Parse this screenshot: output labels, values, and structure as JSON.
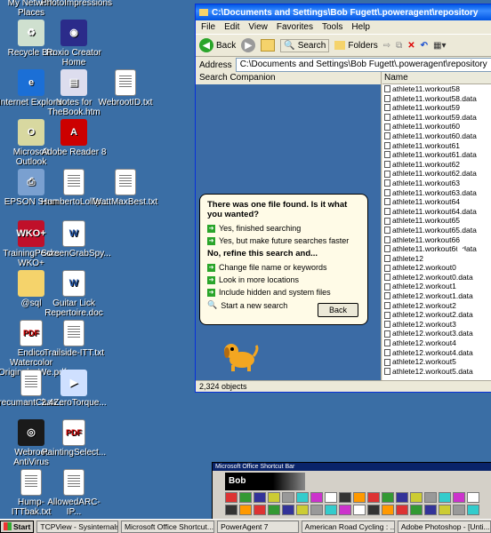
{
  "desktop": {
    "icons": [
      {
        "label": "My Network Places",
        "kind": "network-places"
      },
      {
        "label": "PhotoImpressions",
        "kind": "photoimpression"
      },
      {
        "label": "Recycle Bin",
        "kind": "recycle-bin"
      },
      {
        "label": "Roxio Creator Home",
        "kind": "roxio"
      },
      {
        "label": "Internet Explorer",
        "kind": "ie"
      },
      {
        "label": "Notes for TheBook.htm",
        "kind": "htm"
      },
      {
        "label": "WebrootID.txt",
        "kind": "txt"
      },
      {
        "label": "Microsoft Outlook",
        "kind": "outlook"
      },
      {
        "label": "Adobe Reader 8",
        "kind": "adobe"
      },
      {
        "label": "EPSON Scan",
        "kind": "epson"
      },
      {
        "label": "HumbertoLollip...",
        "kind": "txt"
      },
      {
        "label": "WattMaxBest.txt",
        "kind": "txt"
      },
      {
        "label": "TrainingPeaks WKO+",
        "kind": "wko"
      },
      {
        "label": "ScreenGrabSpy...",
        "kind": "word"
      },
      {
        "label": "@sql",
        "kind": "folder"
      },
      {
        "label": "Guitar Lick Repertoire.doc",
        "kind": "word"
      },
      {
        "label": "Endico Watercolor Originals_We.pdf",
        "kind": "pdf"
      },
      {
        "label": "Trailside-ITT.txt",
        "kind": "txt"
      },
      {
        "label": "recumantChas...",
        "kind": "txt"
      },
      {
        "label": "2.4ZeroTorque...",
        "kind": "movie"
      },
      {
        "label": "Webroot AntiVirus",
        "kind": "webroot"
      },
      {
        "label": "PaintingSelect...",
        "kind": "pdf"
      },
      {
        "label": "Hump-ITTbak.txt",
        "kind": "txt"
      },
      {
        "label": "AllowedARC-IP...",
        "kind": "txt"
      }
    ]
  },
  "explorer": {
    "title": "C:\\Documents and Settings\\Bob Fugett\\.poweragent\\repository",
    "menu": [
      "File",
      "Edit",
      "View",
      "Favorites",
      "Tools",
      "Help"
    ],
    "toolbar": {
      "back": "Back",
      "search": "Search",
      "folders": "Folders"
    },
    "address_label": "Address",
    "address_value": "C:\\Documents and Settings\\Bob Fugett\\.poweragent\\repository",
    "search_companion": {
      "header": "Search Companion",
      "question": "There was one file found.  Is it what you wanted?",
      "yes_options": [
        "Yes, finished searching",
        "Yes, but make future searches faster"
      ],
      "refine_title": "No, refine this search and...",
      "refine_options": [
        "Change file name or keywords",
        "Look in more locations",
        "Include hidden and system files"
      ],
      "new_search": "Start a new search",
      "back_button": "Back"
    },
    "column_name": "Name",
    "files": [
      "athlete11.workout58",
      "athlete11.workout58.data",
      "athlete11.workout59",
      "athlete11.workout59.data",
      "athlete11.workout60",
      "athlete11.workout60.data",
      "athlete11.workout61",
      "athlete11.workout61.data",
      "athlete11.workout62",
      "athlete11.workout62.data",
      "athlete11.workout63",
      "athlete11.workout63.data",
      "athlete11.workout64",
      "athlete11.workout64.data",
      "athlete11.workout65",
      "athlete11.workout65.data",
      "athlete11.workout66",
      "athlete11.workout66.data",
      "athlete12",
      "athlete12.workout0",
      "athlete12.workout0.data",
      "athlete12.workout1",
      "athlete12.workout1.data",
      "athlete12.workout2",
      "athlete12.workout2.data",
      "athlete12.workout3",
      "athlete12.workout3.data",
      "athlete12.workout4",
      "athlete12.workout4.data",
      "athlete12.workout5",
      "athlete12.workout5.data"
    ],
    "status": "2,324 objects"
  },
  "shortcut_bar": {
    "title": "Microsoft Office Shortcut Bar",
    "name": "Bob"
  },
  "taskbar": {
    "start": "Start",
    "tasks": [
      "TCPView - Sysinternals: ...",
      "Microsoft Office Shortcut...",
      "PowerAgent 7",
      "American Road Cycling : ...",
      "Adobe Photoshop - [Unti..."
    ]
  },
  "colors": {
    "desktop": "#3a6ea5",
    "xp_blue": "#0054e3"
  }
}
